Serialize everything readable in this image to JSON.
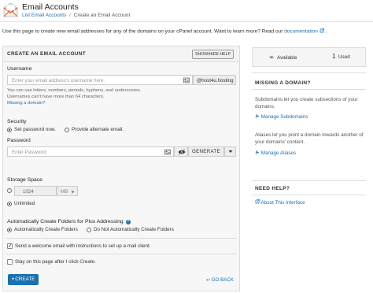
{
  "header": {
    "title": "Email Accounts",
    "breadcrumb": {
      "link": "List Email Accounts",
      "separator": "/",
      "current": "Create an Email Account"
    },
    "intro": "Use this page to create new email addresses for any of the domains on your cPanel account. Want to learn more? Read our",
    "intro_link": "documentation"
  },
  "form": {
    "section_title": "CREATE AN EMAIL ACCOUNT",
    "show_hide_help": "SHOW/HIDE HELP",
    "username": {
      "label": "Username",
      "placeholder": "Enter your email address's username here.",
      "domain": "@host4u.hosting",
      "help_1": "You can use letters, numbers, periods, hyphens, and underscores.",
      "help_2": "Usernames can't have more than 64 characters.",
      "missing_domain_link": "Missing a domain?"
    },
    "security": {
      "label": "Security",
      "option_set": "Set password now.",
      "option_alternate": "Provide alternate email."
    },
    "password": {
      "label": "Password",
      "placeholder": "Enter Password",
      "generate": "GENERATE"
    },
    "storage": {
      "label": "Storage Space",
      "value": "1024",
      "unit": "MB",
      "unlimited": "Unlimited"
    },
    "plus_addressing": {
      "label": "Automatically Create Folders for Plus Addressing",
      "option_auto": "Automatically Create Folders",
      "option_no": "Do Not Automatically Create Folders"
    },
    "welcome_email": "Send a welcome email with instructions to set up a mail client.",
    "stay_on_page": "Stay on this page after I click",
    "stay_on_page_em": "Create",
    "stay_on_page_end": ".",
    "create_button": "CREATE",
    "go_back": "GO BACK"
  },
  "sidebar": {
    "available_label": "Available",
    "used_count": "1",
    "used_label": "Used",
    "missing_domain": {
      "title": "MISSING A DOMAIN?",
      "text": "Subdomains let you create subsections of your domains.",
      "link": "Manage Subdomains",
      "text_2": "Aliases let you point a domain towards another of your domains' content.",
      "link_2": "Manage Aliases"
    },
    "need_help": {
      "title": "NEED HELP?",
      "link": "About This Interface"
    }
  },
  "colors": {
    "accent": "#1a6fb0",
    "link": "#1b6fb0",
    "header_icon": "#e8622a"
  }
}
